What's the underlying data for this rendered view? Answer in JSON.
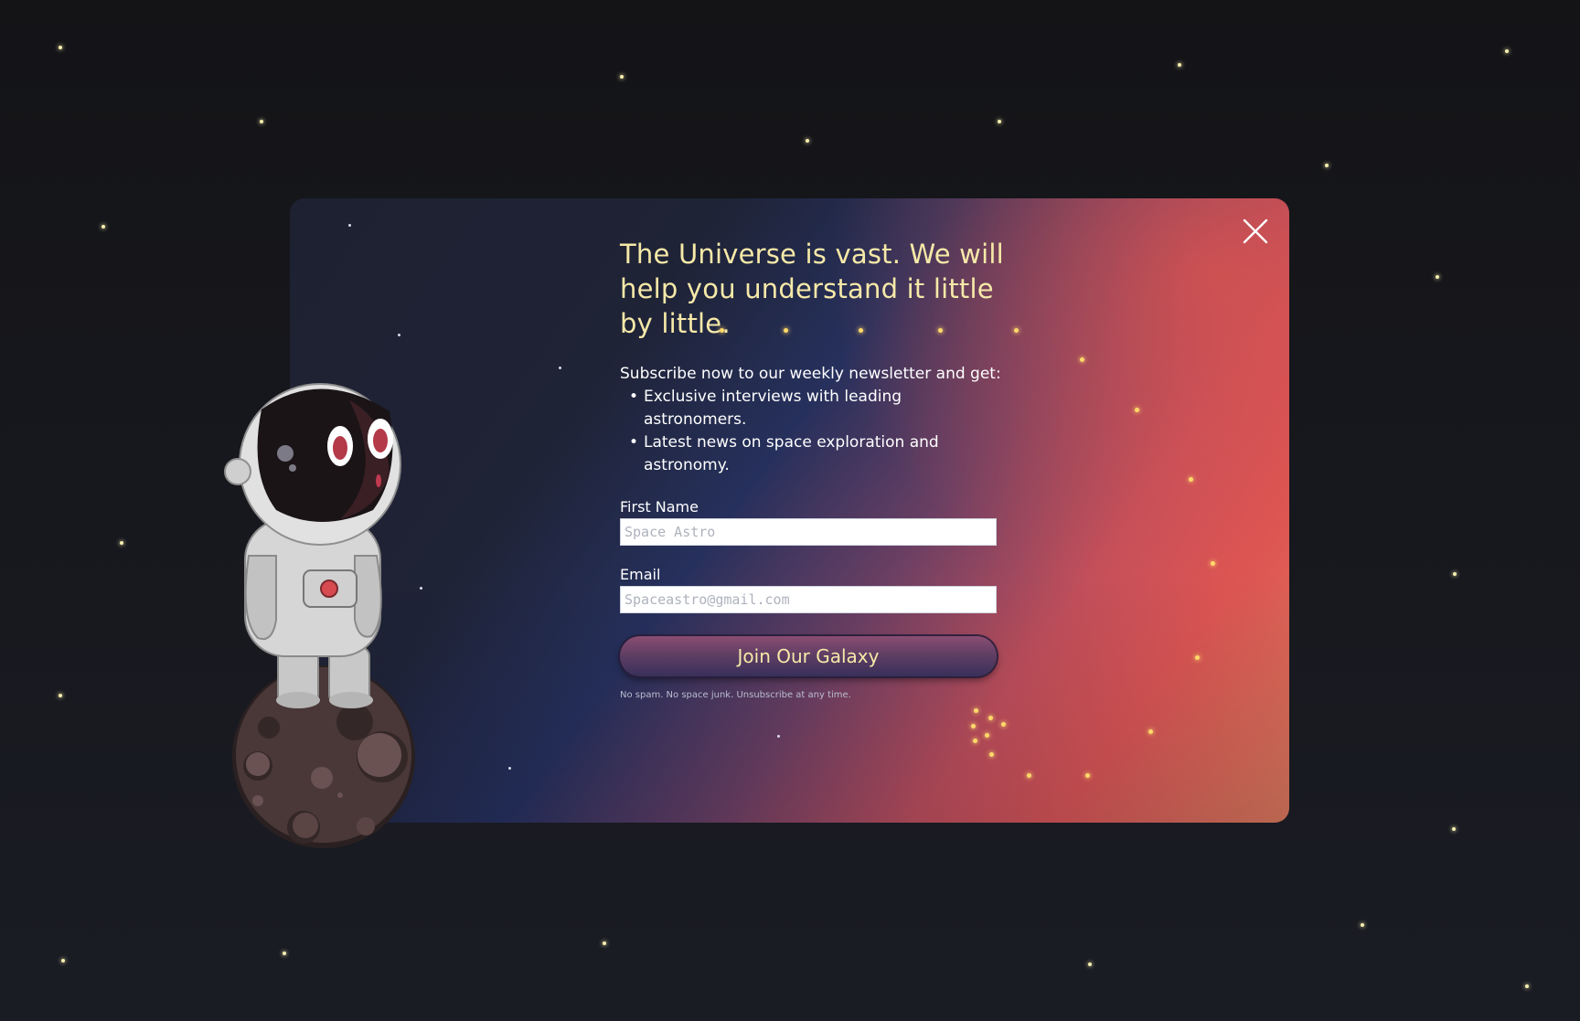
{
  "modal": {
    "headline": "The Universe is vast. We will help you understand it little by little.",
    "intro": "Subscribe now to our weekly newsletter and get:",
    "benefits": [
      "Exclusive interviews with leading astronomers.",
      "Latest news on space exploration and astronomy."
    ],
    "bullet": "•",
    "first_name": {
      "label": "First Name",
      "placeholder": "Space Astro",
      "value": ""
    },
    "email": {
      "label": "Email",
      "placeholder": "Spaceastro@gmail.com",
      "value": ""
    },
    "submit_label": "Join Our Galaxy",
    "fine_print": "No spam. No space junk. Unsubscribe at any time.",
    "close_icon": "close-icon"
  },
  "illustration": {
    "subject": "astronaut-on-asteroid"
  },
  "colors": {
    "headline": "#f6e9a8",
    "page_background": "#17181d",
    "card_dark": "#1e2131",
    "card_blue": "#26305c",
    "card_red": "#dd5553",
    "card_orange": "#e07a59",
    "button_top": "#8a4d72",
    "button_bottom": "#38305a",
    "button_text": "#f6e9a8",
    "star": "#ffd86a"
  }
}
